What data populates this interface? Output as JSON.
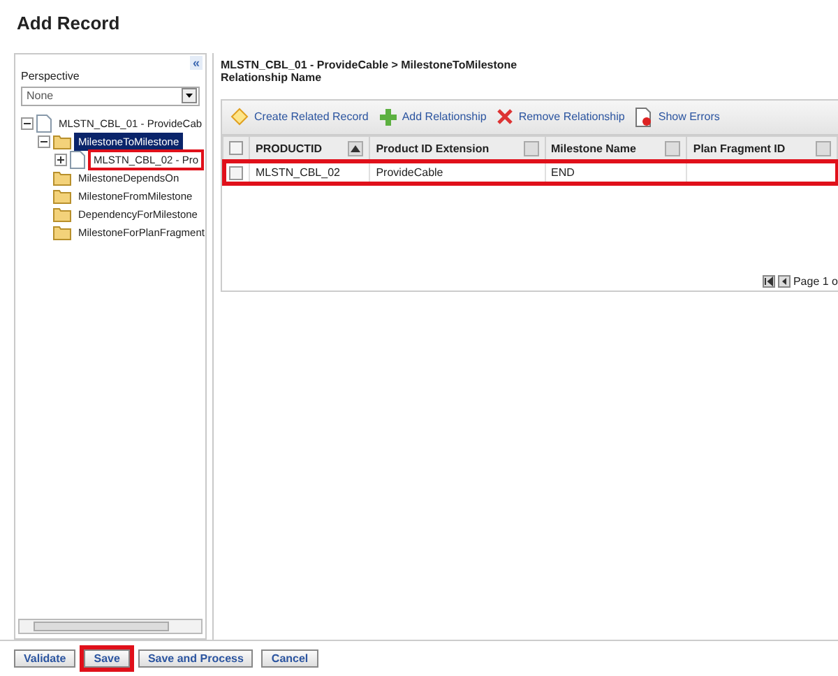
{
  "title": "Add Record",
  "sidebar": {
    "collapse_glyph": "«",
    "perspective_label": "Perspective",
    "perspective_value": "None",
    "tree": [
      {
        "label": "MLSTN_CBL_01 - ProvideCab",
        "kind": "record",
        "expanded": true,
        "selected": false,
        "highlighted": false,
        "children": [
          {
            "label": "MilestoneToMilestone",
            "kind": "folder",
            "expanded": true,
            "selected": true,
            "highlighted": false,
            "children": [
              {
                "label": "MLSTN_CBL_02 - Pro",
                "kind": "record",
                "expanded": false,
                "selected": false,
                "highlighted": true
              }
            ]
          },
          {
            "label": "MilestoneDependsOn",
            "kind": "folder",
            "selected": false,
            "highlighted": false
          },
          {
            "label": "MilestoneFromMilestone",
            "kind": "folder",
            "selected": false,
            "highlighted": false
          },
          {
            "label": "DependencyForMilestone",
            "kind": "folder",
            "selected": false,
            "highlighted": false
          },
          {
            "label": "MilestoneForPlanFragment",
            "kind": "folder",
            "selected": false,
            "highlighted": false
          }
        ]
      }
    ]
  },
  "main": {
    "breadcrumb": "MLSTN_CBL_01 - ProvideCable > MilestoneToMilestone",
    "subtitle": "Relationship Name",
    "toolbar": [
      {
        "label": "Create Related Record",
        "kind": "create"
      },
      {
        "label": "Add Relationship",
        "kind": "add"
      },
      {
        "label": "Remove Relationship",
        "kind": "remove"
      },
      {
        "label": "Show Errors",
        "kind": "errors"
      }
    ],
    "table": {
      "all_checked": false,
      "columns": [
        {
          "label": "PRODUCTID",
          "sorted": true
        },
        {
          "label": "Product ID Extension",
          "sorted": false
        },
        {
          "label": "Milestone Name",
          "sorted": false
        },
        {
          "label": "Plan Fragment ID",
          "sorted": false
        }
      ],
      "rows": [
        {
          "checked": false,
          "highlighted": true,
          "cells": [
            "MLSTN_CBL_02",
            "ProvideCable",
            "END",
            ""
          ]
        }
      ]
    },
    "pager": "Page 1 o"
  },
  "buttons": [
    {
      "label": "Validate",
      "highlighted": false
    },
    {
      "label": "Save",
      "highlighted": true
    },
    {
      "label": "Save and Process",
      "highlighted": false
    },
    {
      "label": "Cancel",
      "highlighted": false
    }
  ]
}
